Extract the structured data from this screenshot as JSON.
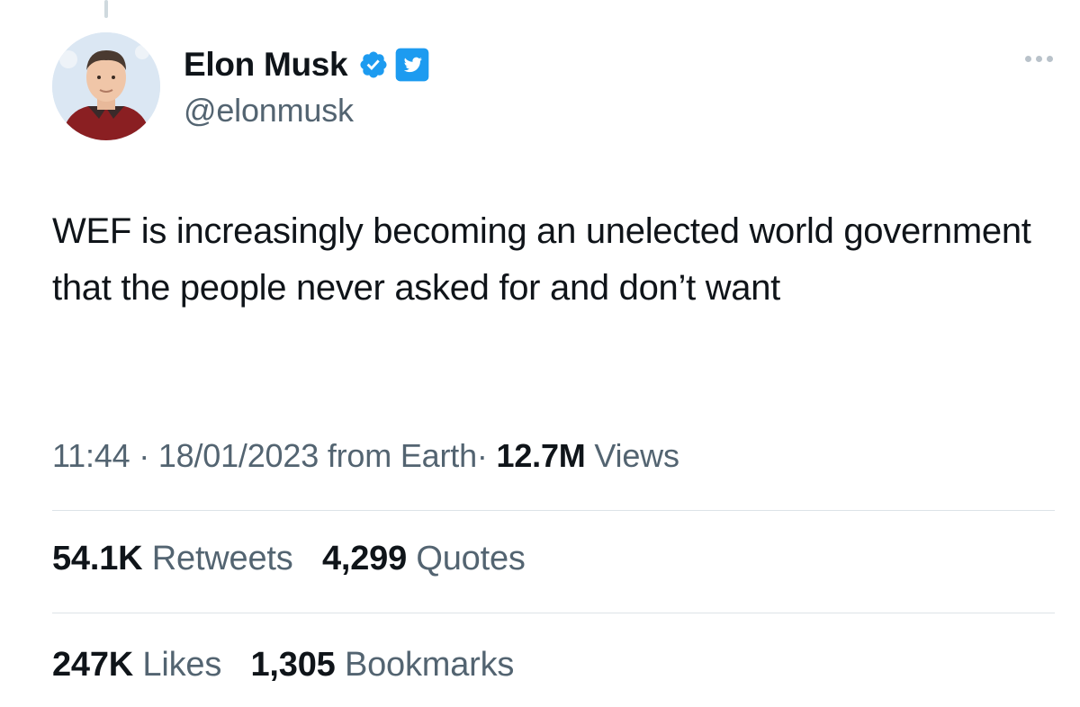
{
  "tweet": {
    "author": {
      "name": "Elon Musk",
      "handle": "@elonmusk",
      "verified": true
    },
    "text": "WEF is increasingly becoming an unelected world government that the people never asked for and don’t want",
    "meta": {
      "time": "11:44",
      "separator": "·",
      "date": "18/01/2023",
      "source": "from Earth",
      "views_count": "12.7M",
      "views_label": "Views"
    },
    "stats_row1": [
      {
        "count": "54.1K",
        "label": "Retweets"
      },
      {
        "count": "4,299",
        "label": "Quotes"
      }
    ],
    "stats_row2": [
      {
        "count": "247K",
        "label": "Likes"
      },
      {
        "count": "1,305",
        "label": "Bookmarks"
      }
    ]
  },
  "colors": {
    "text_primary": "#0f1419",
    "text_secondary": "#536471",
    "verified_blue": "#1d9bf0",
    "divider": "#dde3e8"
  },
  "icons": {
    "verified": "verified-badge-icon",
    "twitter": "twitter-bird-icon",
    "more": "more-horizontal-icon"
  }
}
